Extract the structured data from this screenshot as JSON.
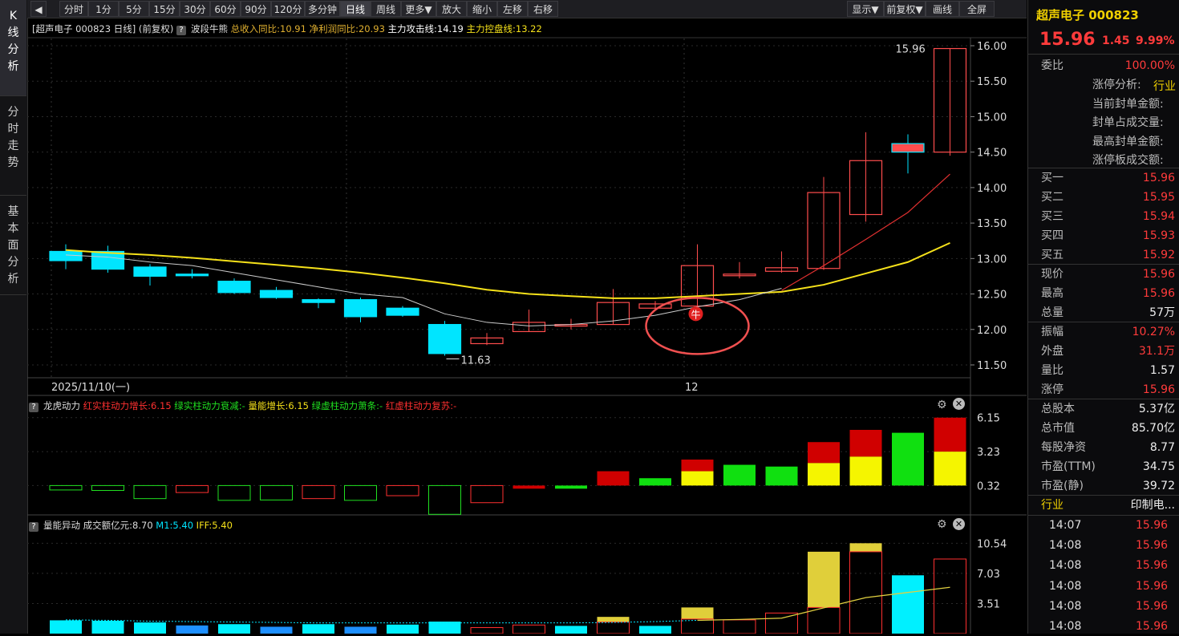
{
  "toolbar": {
    "back_icon": "back-arrow-icon",
    "buttons": [
      "分时",
      "1分",
      "5分",
      "15分",
      "30分",
      "60分",
      "90分",
      "120分",
      "多分钟",
      "日线",
      "周线",
      "更多▼",
      "放大",
      "缩小",
      "左移",
      "右移"
    ],
    "right_buttons": [
      "显示▼",
      "前复权▼",
      "画线",
      "全屏"
    ]
  },
  "left_tabs": [
    "K\n线\n分\n析",
    "分\n时\n走\n势",
    "基\n本\n面\n分\n析"
  ],
  "main_chart": {
    "title": "[超声电子 000823 日线]",
    "adjust": "(前复权)",
    "indicator_name": "波段牛熊",
    "ind1": "总收入同比:10.91",
    "ind2": "净利润同比:20.93",
    "ind3": "主力攻击线:14.19",
    "ind4": "主力控盘线:13.22",
    "date_label": "2025/11/10(一)",
    "month_label": "12",
    "high_label": "15.96",
    "low_label": "11.63",
    "bull_badge": "牛",
    "colors": {
      "up": "#ff4d4d",
      "down": "#00e5ff",
      "line_white": "#cccccc",
      "line_yellow": "#f5e11a",
      "line_red": "#e03030"
    }
  },
  "chart_data": [
    {
      "type": "candlestick",
      "title": "",
      "ylim": [
        11.4,
        16.1
      ],
      "yticks": [
        "16.00",
        "15.50",
        "15.00",
        "14.50",
        "14.00",
        "13.50",
        "13.00",
        "12.50",
        "12.00",
        "11.50"
      ],
      "ytick_values": [
        16.0,
        15.5,
        15.0,
        14.5,
        14.0,
        13.5,
        13.0,
        12.5,
        12.0,
        11.5
      ],
      "candles": [
        {
          "o": 13.1,
          "c": 12.97,
          "h": 13.2,
          "l": 12.85
        },
        {
          "o": 13.1,
          "c": 12.85,
          "h": 13.18,
          "l": 12.8
        },
        {
          "o": 12.88,
          "c": 12.75,
          "h": 12.92,
          "l": 12.62
        },
        {
          "o": 12.78,
          "c": 12.76,
          "h": 12.85,
          "l": 12.72
        },
        {
          "o": 12.68,
          "c": 12.52,
          "h": 12.72,
          "l": 12.5
        },
        {
          "o": 12.55,
          "c": 12.45,
          "h": 12.6,
          "l": 12.43
        },
        {
          "o": 12.42,
          "c": 12.38,
          "h": 12.44,
          "l": 12.3
        },
        {
          "o": 12.42,
          "c": 12.18,
          "h": 12.45,
          "l": 12.1
        },
        {
          "o": 12.3,
          "c": 12.2,
          "h": 12.33,
          "l": 12.18
        },
        {
          "o": 12.07,
          "c": 11.66,
          "h": 12.12,
          "l": 11.63
        },
        {
          "o": 11.8,
          "c": 11.88,
          "h": 11.95,
          "l": 11.78
        },
        {
          "o": 11.97,
          "c": 12.1,
          "h": 12.28,
          "l": 11.97
        },
        {
          "o": 12.05,
          "c": 12.07,
          "h": 12.15,
          "l": 12.0
        },
        {
          "o": 12.07,
          "c": 12.38,
          "h": 12.57,
          "l": 12.07
        },
        {
          "o": 12.3,
          "c": 12.36,
          "h": 12.4,
          "l": 12.28
        },
        {
          "o": 12.33,
          "c": 12.9,
          "h": 13.2,
          "l": 12.28
        },
        {
          "o": 12.76,
          "c": 12.78,
          "h": 12.95,
          "l": 12.72
        },
        {
          "o": 12.82,
          "c": 12.87,
          "h": 13.1,
          "l": 12.8
        },
        {
          "o": 12.86,
          "c": 13.93,
          "h": 14.15,
          "l": 12.84
        },
        {
          "o": 13.62,
          "c": 14.38,
          "h": 14.78,
          "l": 13.52
        },
        {
          "o": 14.62,
          "c": 14.5,
          "h": 14.75,
          "l": 14.2
        },
        {
          "o": 14.5,
          "c": 15.96,
          "h": 15.96,
          "l": 14.45
        }
      ],
      "series": [
        {
          "name": "主力控盘线",
          "values": [
            13.12,
            13.08,
            13.05,
            13.01,
            12.96,
            12.91,
            12.86,
            12.8,
            12.73,
            12.65,
            12.56,
            12.5,
            12.47,
            12.44,
            12.44,
            12.47,
            12.5,
            12.53,
            12.63,
            12.79,
            12.95,
            13.22
          ]
        },
        {
          "name": "",
          "values": [
            13.05,
            13.02,
            12.95,
            12.9,
            12.8,
            12.7,
            12.6,
            12.5,
            12.45,
            12.22,
            12.1,
            12.05,
            12.07,
            12.12,
            12.2,
            12.32,
            12.42,
            12.58
          ]
        },
        {
          "name": "主力攻击线",
          "values": [
            12.55,
            12.9,
            13.27,
            13.65,
            14.19
          ]
        }
      ]
    },
    {
      "type": "bar",
      "title": "龙虎动力",
      "legend": [
        "红实柱动力增长:6.15",
        "绿实柱动力衰减:-",
        "量能增长:6.15",
        "绿虚柱动力萧条:-",
        "红虚柱动力复苏:-"
      ],
      "yticks": [
        "6.15",
        "3.23",
        "0.32"
      ],
      "ytick_values": [
        6.15,
        3.23,
        0.32
      ],
      "ylim": [
        -2.2,
        6.2
      ],
      "bars": [
        {
          "top": 0.32,
          "bottom": -0.06,
          "kind": "green-hollow"
        },
        {
          "top": 0.32,
          "bottom": -0.1,
          "kind": "green-hollow"
        },
        {
          "top": 0.32,
          "bottom": -0.8,
          "kind": "green-hollow"
        },
        {
          "top": 0.32,
          "bottom": -0.28,
          "kind": "red-hollow"
        },
        {
          "top": 0.32,
          "bottom": -0.95,
          "kind": "green-hollow"
        },
        {
          "top": 0.32,
          "bottom": -0.92,
          "kind": "green-hollow"
        },
        {
          "top": 0.32,
          "bottom": -0.8,
          "kind": "red-hollow"
        },
        {
          "top": 0.32,
          "bottom": -0.95,
          "kind": "green-hollow"
        },
        {
          "top": 0.32,
          "bottom": -0.55,
          "kind": "red-hollow"
        },
        {
          "top": 0.32,
          "bottom": -2.15,
          "kind": "green-hollow"
        },
        {
          "top": 0.32,
          "bottom": -1.15,
          "kind": "red-hollow"
        },
        {
          "top": 0.32,
          "bottom": 0.05,
          "kind": "red-solid"
        },
        {
          "top": 0.32,
          "bottom": 0.05,
          "kind": "green-solid"
        },
        {
          "top": 1.55,
          "bottom": 0.32,
          "kind": "red-solid"
        },
        {
          "top": 0.95,
          "bottom": 0.32,
          "kind": "green-solid"
        },
        {
          "top": 2.55,
          "bottom": 0.32,
          "kind": "red-yellow",
          "split": 1.55
        },
        {
          "top": 2.1,
          "bottom": 0.32,
          "kind": "green-solid"
        },
        {
          "top": 1.95,
          "bottom": 0.32,
          "kind": "green-solid"
        },
        {
          "top": 4.05,
          "bottom": 0.32,
          "kind": "red-yellow",
          "split": 2.25
        },
        {
          "top": 5.1,
          "bottom": 0.32,
          "kind": "red-yellow",
          "split": 2.8
        },
        {
          "top": 4.85,
          "bottom": 0.32,
          "kind": "green-solid"
        },
        {
          "top": 6.15,
          "bottom": 0.32,
          "kind": "red-yellow",
          "split": 3.23
        }
      ]
    },
    {
      "type": "bar",
      "title": "量能异动",
      "legend": [
        "成交额亿元:8.70",
        "M1:5.40",
        "IFF:5.40"
      ],
      "yticks": [
        "10.54",
        "7.03",
        "3.51"
      ],
      "ytick_values": [
        10.54,
        7.03,
        3.51
      ],
      "ylim": [
        0,
        11.6
      ],
      "bars": [
        {
          "v": 1.55,
          "kind": "cyan"
        },
        {
          "v": 1.5,
          "kind": "cyan"
        },
        {
          "v": 1.3,
          "kind": "cyan"
        },
        {
          "v": 0.95,
          "kind": "blue"
        },
        {
          "v": 1.1,
          "kind": "cyan"
        },
        {
          "v": 0.8,
          "kind": "blue"
        },
        {
          "v": 1.1,
          "kind": "cyan"
        },
        {
          "v": 0.8,
          "kind": "blue"
        },
        {
          "v": 1.05,
          "kind": "cyan"
        },
        {
          "v": 1.4,
          "kind": "cyan"
        },
        {
          "v": 0.7,
          "kind": "red-hollow"
        },
        {
          "v": 1.0,
          "kind": "red-hollow"
        },
        {
          "v": 0.9,
          "kind": "cyan"
        },
        {
          "v": 1.95,
          "kind": "red-yellow",
          "split": 1.35
        },
        {
          "v": 0.9,
          "kind": "cyan"
        },
        {
          "v": 3.05,
          "kind": "red-yellow",
          "split": 1.7
        },
        {
          "v": 1.6,
          "kind": "red-hollow"
        },
        {
          "v": 2.4,
          "kind": "red-hollow"
        },
        {
          "v": 9.55,
          "kind": "red-yellow",
          "split": 3.05
        },
        {
          "v": 10.54,
          "kind": "red-yellow",
          "split": 9.55
        },
        {
          "v": 6.8,
          "kind": "cyan"
        },
        {
          "v": 8.7,
          "kind": "red-hollow"
        }
      ],
      "series": [
        {
          "name": "M1",
          "values": [
            1.6,
            1.55,
            1.45,
            1.4,
            1.35,
            1.3,
            1.25,
            1.25,
            1.25,
            1.25,
            1.25,
            1.25,
            1.25,
            1.3,
            1.4,
            1.55,
            1.65,
            1.8,
            3.0,
            4.2,
            4.8,
            5.4
          ]
        }
      ]
    }
  ],
  "sub1": {
    "title": "龙虎动力",
    "l1": "红实柱动力增长:6.15",
    "l2": "绿实柱动力衰减:-",
    "l3": "量能增长:6.15",
    "l4": "绿虚柱动力萧条:-",
    "l5": "红虚柱动力复苏:-"
  },
  "sub2": {
    "title": "量能异动",
    "l1": "成交额亿元:8.70",
    "l2": "M1:5.40",
    "l3": "IFF:5.40"
  },
  "panel_icons": [
    "gear-icon",
    "close-icon"
  ],
  "right_panel": {
    "name": "超声电子 000823",
    "price": "15.96",
    "change": "1.45",
    "pct": "9.99%",
    "weibi_label": "委比",
    "weibi_value": "100.00%",
    "limit_items": [
      "涨停分析:",
      "当前封单金额:",
      "封单占成交量:",
      "最高封单金额:",
      "涨停板成交额:"
    ],
    "limit_tag": "行业",
    "bids": [
      {
        "label": "买一",
        "value": "15.96"
      },
      {
        "label": "买二",
        "value": "15.95"
      },
      {
        "label": "买三",
        "value": "15.94"
      },
      {
        "label": "买四",
        "value": "15.93"
      },
      {
        "label": "买五",
        "value": "15.92"
      }
    ],
    "stats1": [
      {
        "label": "现价",
        "value": "15.96",
        "color": "red"
      },
      {
        "label": "最高",
        "value": "15.96",
        "color": "red"
      },
      {
        "label": "总量",
        "value": "57万",
        "color": "white"
      }
    ],
    "stats2": [
      {
        "label": "振幅",
        "value": "10.27%",
        "color": "red"
      },
      {
        "label": "外盘",
        "value": "31.1万",
        "color": "red"
      },
      {
        "label": "量比",
        "value": "1.57",
        "color": "white"
      },
      {
        "label": "涨停",
        "value": "15.96",
        "color": "red"
      }
    ],
    "stats3": [
      {
        "label": "总股本",
        "value": "5.37亿",
        "color": "white"
      },
      {
        "label": "总市值",
        "value": "85.70亿",
        "color": "white"
      },
      {
        "label": "每股净资",
        "value": "8.77",
        "color": "white"
      },
      {
        "label": "市盈(TTM)",
        "value": "34.75",
        "color": "white"
      },
      {
        "label": "市盈(静)",
        "value": "39.72",
        "color": "white"
      }
    ],
    "industry_label": "行业",
    "industry_value": "印制电...",
    "ticks": [
      {
        "time": "14:07",
        "price": "15.96"
      },
      {
        "time": "14:08",
        "price": "15.96"
      },
      {
        "time": "14:08",
        "price": "15.96"
      },
      {
        "time": "14:08",
        "price": "15.96"
      },
      {
        "time": "14:08",
        "price": "15.96"
      },
      {
        "time": "14:08",
        "price": "15.96"
      }
    ]
  }
}
